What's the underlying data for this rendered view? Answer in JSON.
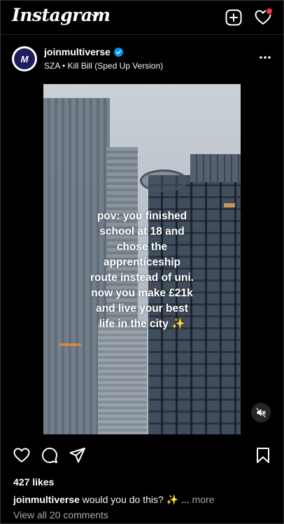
{
  "app": {
    "logo_text": "Instagram"
  },
  "post": {
    "username": "joinmultiverse",
    "avatar_text": "M",
    "audio": "SZA • Kill Bill (Sped Up Version)",
    "overlay_text": "pov: you finished\nschool at 18 and\nchose the\napprenticeship\nroute instead of uni.\nnow you make £21k\nand live your best\nlife in the city ✨",
    "likes": "427 likes",
    "caption_user": "joinmultiverse",
    "caption_text": " would you do this? ✨ ... ",
    "caption_more": "more",
    "comments_link": "View all 20 comments"
  },
  "icons": {
    "new_post": "plus-square-icon",
    "activity": "heart-icon",
    "verified": "verified-badge-icon",
    "more": "more-horizontal-icon",
    "mute": "speaker-muted-icon",
    "like": "heart-icon",
    "comment": "comment-icon",
    "share": "send-icon",
    "save": "bookmark-icon"
  },
  "colors": {
    "verified": "#0095f6",
    "notification_dot": "#ff3040",
    "background": "#000000"
  }
}
